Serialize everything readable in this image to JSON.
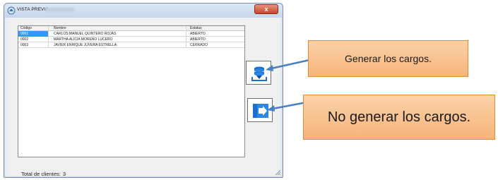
{
  "window": {
    "title": "VISTA PREVIA",
    "close_glyph": "x"
  },
  "grid": {
    "columns": [
      "Código",
      "Nombre",
      "Estatus"
    ],
    "rows": [
      {
        "codigo": "0001",
        "nombre": "CARLOS MANUEL QUINTERO ROJAS",
        "estatus": "ABIERTO"
      },
      {
        "codigo": "0002",
        "nombre": "MARTHA ALICIA MORENO LUCERO",
        "estatus": "ABIERTO"
      },
      {
        "codigo": "0003",
        "nombre": "JAVIER ENRIQUE JUVERA ESTRELLA",
        "estatus": "CERRADO"
      }
    ],
    "selected_row": 0,
    "selection_color": "#3399ff"
  },
  "footer": {
    "label": "Total de clientes:",
    "count": "3"
  },
  "buttons": {
    "generate_icon": "download-stack-icon",
    "exit_icon": "exit-door-icon"
  },
  "callouts": {
    "generate": "Generar los cargos.",
    "exit": "No generar los cargos."
  },
  "colors": {
    "callout_fill": "#f6b47a",
    "callout_border": "#e68a2e",
    "arrow": "#4a7fc0",
    "icon_blue": "#1c6fd1"
  }
}
